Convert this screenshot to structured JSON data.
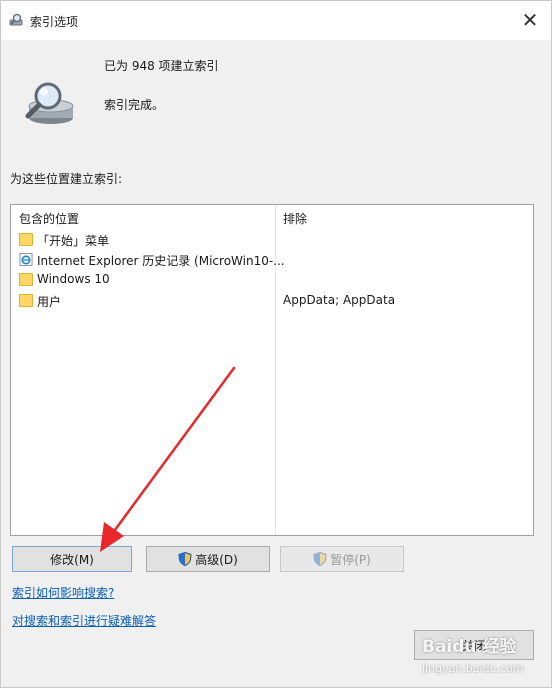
{
  "window": {
    "title": "索引选项",
    "close_glyph": "✕"
  },
  "status": {
    "indexed_count_text": "已为 948 项建立索引",
    "state_text": "索引完成。"
  },
  "locations_label": "为这些位置建立索引:",
  "table": {
    "headers": {
      "included": "包含的位置",
      "excluded": "排除"
    },
    "rows": [
      {
        "icon": "folder-icon",
        "name": "「开始」菜单",
        "exclude": ""
      },
      {
        "icon": "internet-explorer-icon",
        "name": "Internet Explorer 历史记录 (MicroWin10-...",
        "exclude": ""
      },
      {
        "icon": "folder-icon",
        "name": "Windows 10",
        "exclude": ""
      },
      {
        "icon": "folder-icon",
        "name": "用户",
        "exclude": "AppData; AppData"
      }
    ]
  },
  "buttons": {
    "modify": "修改(M)",
    "advanced": "高级(D)",
    "pause": "暂停(P)",
    "close": "关闭"
  },
  "links": {
    "how_affects": "索引如何影响搜索?",
    "troubleshoot": "对搜索和索引进行疑难解答"
  },
  "annotation": {
    "arrow_color": "#e8282b"
  },
  "watermark": {
    "text": "Baidu 经验",
    "sub": "jingyan.baidu.com"
  },
  "colors": {
    "link": "#0a5fb3",
    "folder": "#ffd766",
    "window_bg": "#f0f0f0"
  }
}
